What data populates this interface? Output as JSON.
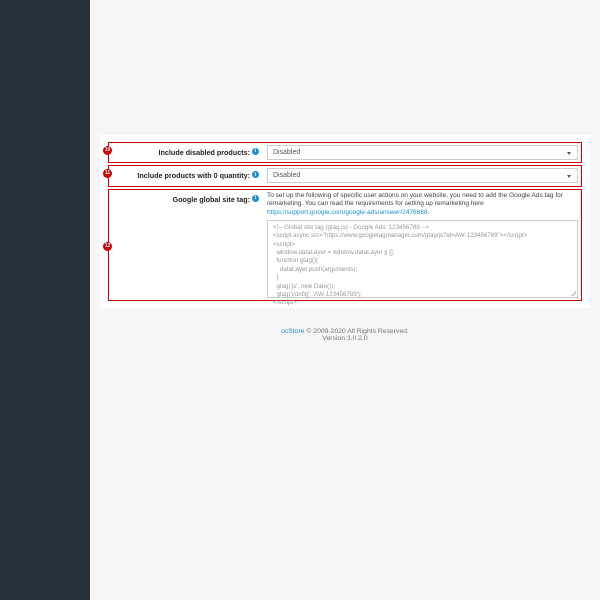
{
  "badges": {
    "r10": "10",
    "r11": "11",
    "r12": "12"
  },
  "labels": {
    "include_disabled": "Include disabled products:",
    "include_zero": "Include products with 0 quantity:",
    "site_tag": "Google global site tag:"
  },
  "values": {
    "include_disabled": "Disabled",
    "include_zero": "Disabled"
  },
  "site_tag": {
    "desc_pre": "To set up the following of specific user actions on your website, you need to add the Google Ads tag for remarketing. You can read the requirements for setting up remarketing here ",
    "link_text": "https://support.google.com/google-ads/answer/2476688",
    "desc_post": ".",
    "code": "<!-- Global site tag (gtag.js) - Google Ads: 123456789 -->\n<script async src=\"https://www.googletagmanager.com/gtag/js?id=AW-123456789\"></script>\n<script>\n  window.dataLayer = window.dataLayer || [];\n  function gtag(){\n    dataLayer.push(arguments);\n  }\n  gtag('js', new Date());\n  gtag('config', 'AW-123456789');\n</script>"
  },
  "footer": {
    "brand": "ocStore",
    "rights": " © 2009-2020 All Rights Reserved.",
    "version": "Version 3.0.2.0"
  }
}
